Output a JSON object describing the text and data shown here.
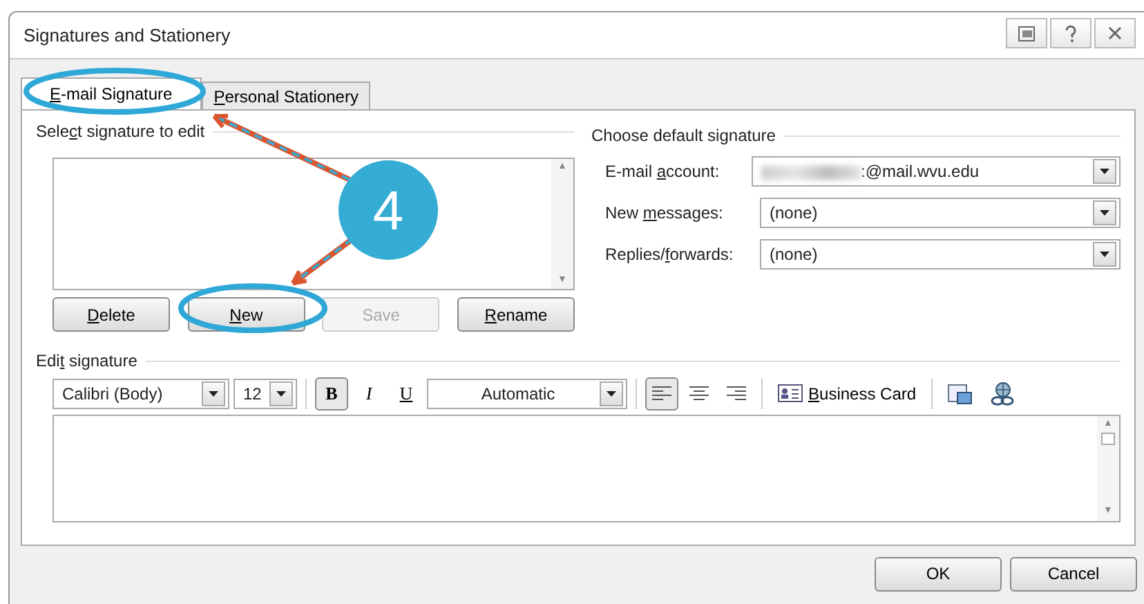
{
  "window": {
    "title": "Signatures and Stationery",
    "title_buttons": [
      {
        "kind": "window"
      },
      {
        "kind": "help"
      },
      {
        "kind": "close"
      }
    ]
  },
  "tabs": [
    {
      "label": {
        "key": "E",
        "post": "-mail Signature"
      },
      "selected": true
    },
    {
      "label": {
        "key": "P",
        "post": "ersonal Stationery"
      },
      "selected": false
    }
  ],
  "select_signature": {
    "label": {
      "pre": "Sele",
      "key": "c",
      "post": "t signature to edit"
    },
    "scroll_arrows": [
      "▲",
      "▼"
    ],
    "buttons": [
      {
        "label": {
          "key": "D",
          "post": "elete"
        },
        "disabled": false
      },
      {
        "label": {
          "key": "N",
          "post": "ew"
        },
        "disabled": false
      },
      {
        "label": "Save",
        "disabled": true
      },
      {
        "label": {
          "key": "R",
          "post": "ename"
        },
        "disabled": false
      }
    ]
  },
  "default_signature": {
    "label": "Choose default signature",
    "fields": [
      {
        "label": {
          "pre": "E-mail ",
          "key": "a",
          "post": "ccount:"
        },
        "value": ":@mail.wvu.edu",
        "redacted": true
      },
      {
        "label": {
          "pre": "New ",
          "key": "m",
          "post": "essages:"
        },
        "value": "(none)"
      },
      {
        "label": {
          "pre": "Replies/",
          "key": "f",
          "post": "orwards:"
        },
        "value": "(none)"
      }
    ]
  },
  "edit_signature": {
    "label": {
      "pre": "Edi",
      "key": "t",
      "post": " signature"
    },
    "font": "Calibri (Body)",
    "size": "12",
    "styles": [
      {
        "kind": "bold",
        "label": "B",
        "pressed": true
      },
      {
        "kind": "italic",
        "label": "I",
        "pressed": false
      },
      {
        "kind": "underline",
        "label": "U",
        "pressed": false
      }
    ],
    "font_color_name": "Automatic",
    "alignments": [
      {
        "kind": "left",
        "selected": true
      },
      {
        "kind": "center",
        "selected": false
      },
      {
        "kind": "right",
        "selected": false
      }
    ],
    "business_card": {
      "key": "B",
      "post": "usiness Card"
    },
    "tools": [
      {
        "kind": "picture"
      },
      {
        "kind": "link"
      }
    ],
    "scroll_arrows": [
      "▲",
      "▼"
    ]
  },
  "footer_buttons": [
    "OK",
    "Cancel"
  ],
  "annotation": {
    "step": "4"
  }
}
